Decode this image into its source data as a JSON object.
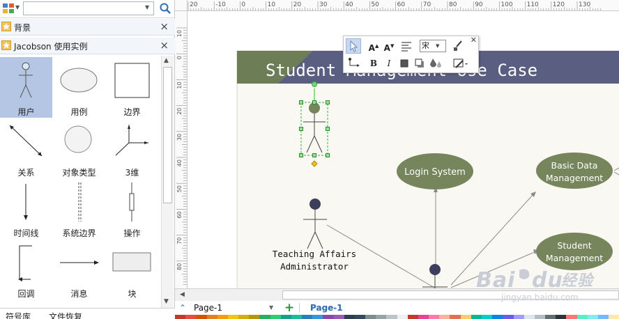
{
  "search": {
    "placeholder": "",
    "value": ""
  },
  "library": {
    "sections": [
      {
        "title": "背景"
      },
      {
        "title": "Jacobson 使用实例"
      }
    ],
    "shapes": [
      {
        "label": "用户",
        "icon": "actor-icon",
        "selected": true
      },
      {
        "label": "用例",
        "icon": "ellipse-icon"
      },
      {
        "label": "边界",
        "icon": "square-icon"
      },
      {
        "label": "关系",
        "icon": "double-arrow-icon"
      },
      {
        "label": "对象类型",
        "icon": "circle-icon"
      },
      {
        "label": "3维",
        "icon": "3d-axes-icon"
      },
      {
        "label": "时间线",
        "icon": "arrow-down-icon"
      },
      {
        "label": "系统边界",
        "icon": "dashed-line-icon"
      },
      {
        "label": "操作",
        "icon": "operation-icon"
      },
      {
        "label": "回调",
        "icon": "callback-arrow-icon"
      },
      {
        "label": "消息",
        "icon": "arrow-right-icon"
      },
      {
        "label": "块",
        "icon": "block-icon"
      }
    ],
    "bottom_tabs": [
      "符号库",
      "文件恢复"
    ]
  },
  "ruler": {
    "h_labels": [
      "20",
      "-10",
      "0",
      "10",
      "20",
      "30",
      "40",
      "50",
      "60",
      "70",
      "80",
      "90",
      "100",
      "110",
      "120",
      "130"
    ],
    "v_labels": [
      "10",
      "0",
      "10",
      "20",
      "30",
      "40",
      "50",
      "60",
      "70",
      "80"
    ]
  },
  "diagram": {
    "title": "Student Management Use Case",
    "use_cases": [
      "Login System",
      "Basic Data Management",
      "Student Management"
    ],
    "actors": [
      {
        "name": "Teaching Affairs Administrator"
      }
    ],
    "colors": {
      "header": "#5a5e80",
      "header_left": "#6d7e57",
      "use_case_fill": "#76855c",
      "background": "#f9f8f3",
      "actor_head": "#3d3d5c",
      "selection": "#2bb82b"
    }
  },
  "mini_toolbar": {
    "font_value": "宋",
    "items": [
      "select-icon",
      "font-grow-icon",
      "font-shrink-icon",
      "align-icon",
      "brush-icon",
      "connector-icon",
      "bold-icon",
      "italic-icon",
      "fill-icon",
      "shadow-icon",
      "color-icon",
      "line-style-icon"
    ]
  },
  "pages": {
    "selector": "Page-1",
    "active_tab": "Page-1"
  },
  "watermark": {
    "url": "jingyan.baidu.com"
  }
}
